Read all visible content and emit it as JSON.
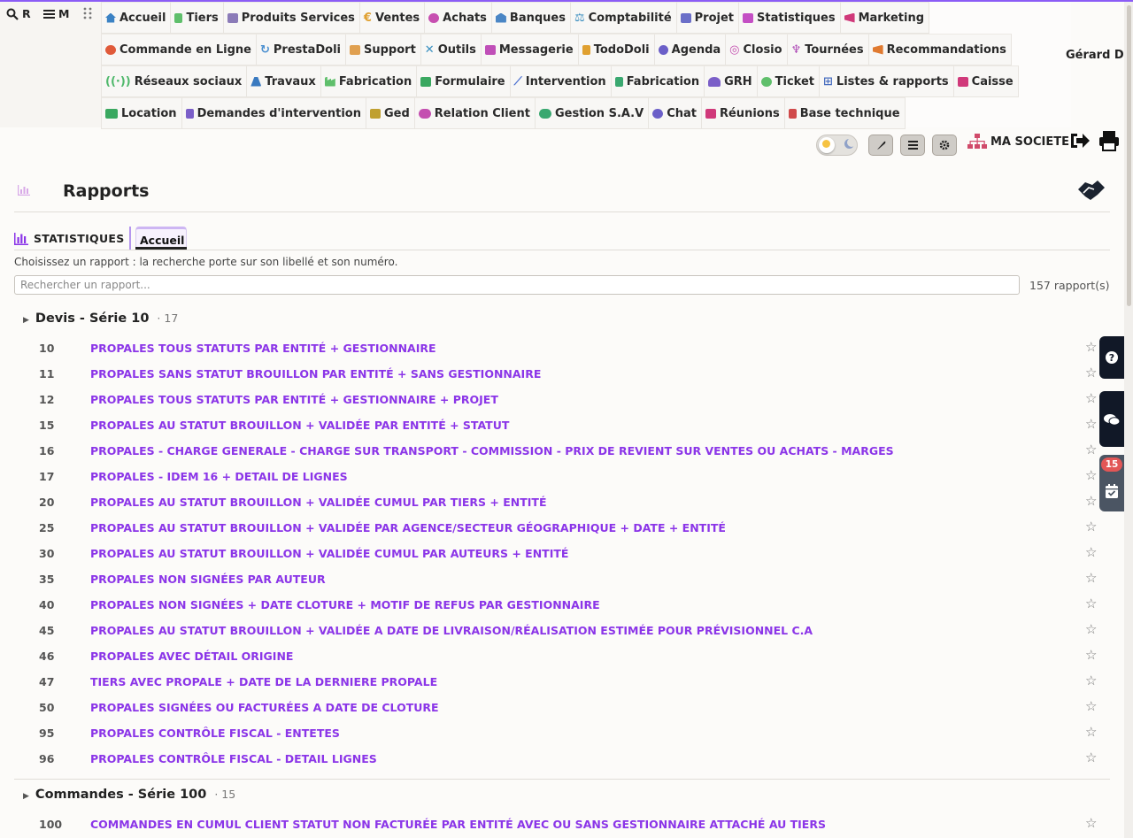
{
  "left_menu": {
    "search_label": "R",
    "menu_label": "M"
  },
  "menu_rows": [
    [
      {
        "label": "Accueil",
        "icon": "home-icon",
        "color": "#3b82c4"
      },
      {
        "label": "Tiers",
        "icon": "building-icon",
        "color": "#5fbf6b"
      },
      {
        "label": "Produits Services",
        "icon": "cubes-icon",
        "color": "#8b7bb8"
      },
      {
        "label": "Ventes",
        "icon": "euro-icon",
        "color": "#e0a030"
      },
      {
        "label": "Achats",
        "icon": "coins-icon",
        "color": "#c74fb0"
      },
      {
        "label": "Banques",
        "icon": "bank-icon",
        "color": "#4a86c5"
      },
      {
        "label": "Comptabilité",
        "icon": "scale-icon",
        "color": "#3d8fc0"
      },
      {
        "label": "Projet",
        "icon": "sitemap-icon",
        "color": "#6b6fc8"
      },
      {
        "label": "Statistiques",
        "icon": "chart-icon",
        "color": "#c44fc4"
      },
      {
        "label": "Marketing",
        "icon": "bullhorn-icon",
        "color": "#d0397a"
      }
    ],
    [
      {
        "label": "Commande en Ligne",
        "icon": "globe-icon",
        "color": "#e05a3a"
      },
      {
        "label": "PrestaDoli",
        "icon": "sync-icon",
        "color": "#4a8fd0"
      },
      {
        "label": "Support",
        "icon": "briefcase-icon",
        "color": "#e0a050"
      },
      {
        "label": "Outils",
        "icon": "tools-icon",
        "color": "#3a90c0"
      },
      {
        "label": "Messagerie",
        "icon": "mail-icon",
        "color": "#c04fb8"
      },
      {
        "label": "TodoDoli",
        "icon": "calendar-check-icon",
        "color": "#e0a030"
      },
      {
        "label": "Agenda",
        "icon": "clock-icon",
        "color": "#6b5fc8"
      },
      {
        "label": "Closio",
        "icon": "target-icon",
        "color": "#c44fb0"
      },
      {
        "label": "Tournées",
        "icon": "route-icon",
        "color": "#b04fb8"
      },
      {
        "label": "Recommandations",
        "icon": "megaphone-icon",
        "color": "#e07a30"
      }
    ],
    [
      {
        "label": "Réseaux sociaux",
        "icon": "broadcast-icon",
        "color": "#4fb86b"
      },
      {
        "label": "Travaux",
        "icon": "road-icon",
        "color": "#3a7ac0"
      },
      {
        "label": "Fabrication",
        "icon": "industry-icon",
        "color": "#5fbf6b"
      },
      {
        "label": "Formulaire",
        "icon": "form-icon",
        "color": "#3aa860"
      },
      {
        "label": "Intervention",
        "icon": "wrench-icon",
        "color": "#4a6fd0"
      },
      {
        "label": "Fabrication",
        "icon": "document-icon",
        "color": "#3aa870"
      },
      {
        "label": "GRH",
        "icon": "users-icon",
        "color": "#7b5fc8"
      },
      {
        "label": "Ticket",
        "icon": "headset-icon",
        "color": "#5fbf6b"
      },
      {
        "label": "Listes & rapports",
        "icon": "table-icon",
        "color": "#4a6fc0"
      },
      {
        "label": "Caisse",
        "icon": "cash-register-icon",
        "color": "#d0397a"
      }
    ],
    [
      {
        "label": "Location",
        "icon": "truck-icon",
        "color": "#3aa860"
      },
      {
        "label": "Demandes d'intervention",
        "icon": "file-plus-icon",
        "color": "#7b5fc8"
      },
      {
        "label": "Ged",
        "icon": "folder-icon",
        "color": "#c0a030"
      },
      {
        "label": "Relation Client",
        "icon": "handshake-icon",
        "color": "#c44fb0"
      },
      {
        "label": "Gestion S.A.V",
        "icon": "handshake-icon",
        "color": "#3aa870"
      },
      {
        "label": "Chat",
        "icon": "comments-icon",
        "color": "#6b5fc8"
      },
      {
        "label": "Réunions",
        "icon": "video-icon",
        "color": "#d0397a"
      },
      {
        "label": "Base technique",
        "icon": "book-icon",
        "color": "#d04a4a"
      }
    ]
  ],
  "user": {
    "name": "Gérard D"
  },
  "company": {
    "name": "MA SOCIETE"
  },
  "page": {
    "title": "Rapports",
    "tab_statistics": "STATISTIQUES",
    "tab_home": "Accueil",
    "hint": "Choisissez un rapport : la recherche porte sur son libellé et son numéro.",
    "search_placeholder": "Rechercher un rapport...",
    "count": "157 rapport(s)"
  },
  "groups": [
    {
      "name": "Devis - Série 10",
      "count": "· 17",
      "rows": [
        {
          "num": "10",
          "label": "PROPALES TOUS STATUTS PAR ENTITÉ + GESTIONNAIRE"
        },
        {
          "num": "11",
          "label": "PROPALES SANS STATUT BROUILLON PAR ENTITÉ + SANS GESTIONNAIRE"
        },
        {
          "num": "12",
          "label": "PROPALES TOUS STATUTS PAR ENTITÉ + GESTIONNAIRE + PROJET"
        },
        {
          "num": "15",
          "label": "PROPALES AU STATUT BROUILLON + VALIDÉE PAR ENTITÉ + STATUT"
        },
        {
          "num": "16",
          "label": "PROPALES - CHARGE GENERALE - CHARGE SUR TRANSPORT - COMMISSION - PRIX DE REVIENT SUR VENTES OU ACHATS - MARGES"
        },
        {
          "num": "17",
          "label": "PROPALES - IDEM 16 + DETAIL DE LIGNES"
        },
        {
          "num": "20",
          "label": "PROPALES AU STATUT BROUILLON + VALIDÉE CUMUL PAR TIERS + ENTITÉ"
        },
        {
          "num": "25",
          "label": "PROPALES AU STATUT BROUILLON + VALIDÉE PAR AGENCE/SECTEUR GÉOGRAPHIQUE + DATE + ENTITÉ"
        },
        {
          "num": "30",
          "label": "PROPALES AU STATUT BROUILLON + VALIDÉE CUMUL PAR AUTEURS + ENTITÉ"
        },
        {
          "num": "35",
          "label": "PROPALES NON SIGNÉES PAR AUTEUR"
        },
        {
          "num": "40",
          "label": "PROPALES NON SIGNÉES + DATE CLOTURE + MOTIF DE REFUS PAR GESTIONNAIRE"
        },
        {
          "num": "45",
          "label": "PROPALES AU STATUT BROUILLON + VALIDÉE A DATE DE LIVRAISON/RÉALISATION ESTIMÉE POUR PRÉVISIONNEL C.A"
        },
        {
          "num": "46",
          "label": "PROPALES AVEC DÉTAIL ORIGINE"
        },
        {
          "num": "47",
          "label": "TIERS AVEC PROPALE + DATE DE LA DERNIERE PROPALE"
        },
        {
          "num": "50",
          "label": "PROPALES SIGNÉES OU FACTURÉES A DATE DE CLOTURE"
        },
        {
          "num": "95",
          "label": "PROPALES CONTRÔLE FISCAL - ENTETES"
        },
        {
          "num": "96",
          "label": "PROPALES CONTRÔLE FISCAL - DETAIL LIGNES"
        }
      ]
    },
    {
      "name": "Commandes - Série 100",
      "count": "· 15",
      "rows": [
        {
          "num": "100",
          "label": "COMMANDES EN CUMUL CLIENT STATUT NON FACTURÉE PAR ENTITÉ AVEC OU SANS GESTIONNAIRE ATTACHÉ AU TIERS"
        }
      ]
    }
  ],
  "star_glyph": "☆",
  "side_panel": {
    "badge": "15"
  },
  "colors": {
    "accent": "#8b35e8",
    "topline": "#8b5cf6",
    "badge": "#e25656"
  }
}
